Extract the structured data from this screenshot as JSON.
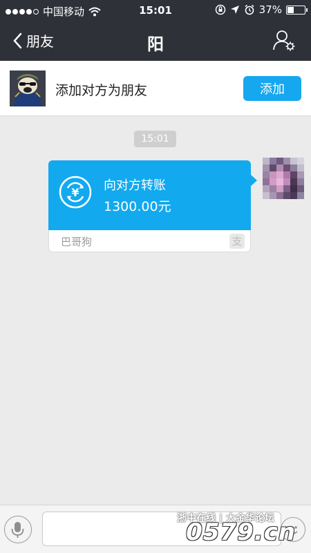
{
  "status_bar": {
    "carrier": "中国移动",
    "time": "15:01",
    "battery": "37%",
    "battery_level": 0.37,
    "signal_icon": "signal-dots-icon",
    "wifi_icon": "wifi-icon"
  },
  "nav": {
    "back_label": "朋友",
    "title": "阳",
    "profile_icon": "person-settings-icon"
  },
  "add_friend": {
    "prompt": "添加对方为朋友",
    "button_label": "添加"
  },
  "chat": {
    "time_label": "15:01",
    "transfer": {
      "title": "向对方转账",
      "amount": "1300.00元",
      "source": "巴哥狗",
      "icon": "yuan-transfer-icon",
      "brand_icon": "alipay-icon",
      "color": "#12a9ef"
    }
  },
  "input_bar": {
    "voice_icon": "microphone-icon",
    "emoji_icon": "emoji-icon"
  },
  "watermark": {
    "line1": "浙中在线 | 大金华论坛",
    "line2": "0579.cn"
  }
}
